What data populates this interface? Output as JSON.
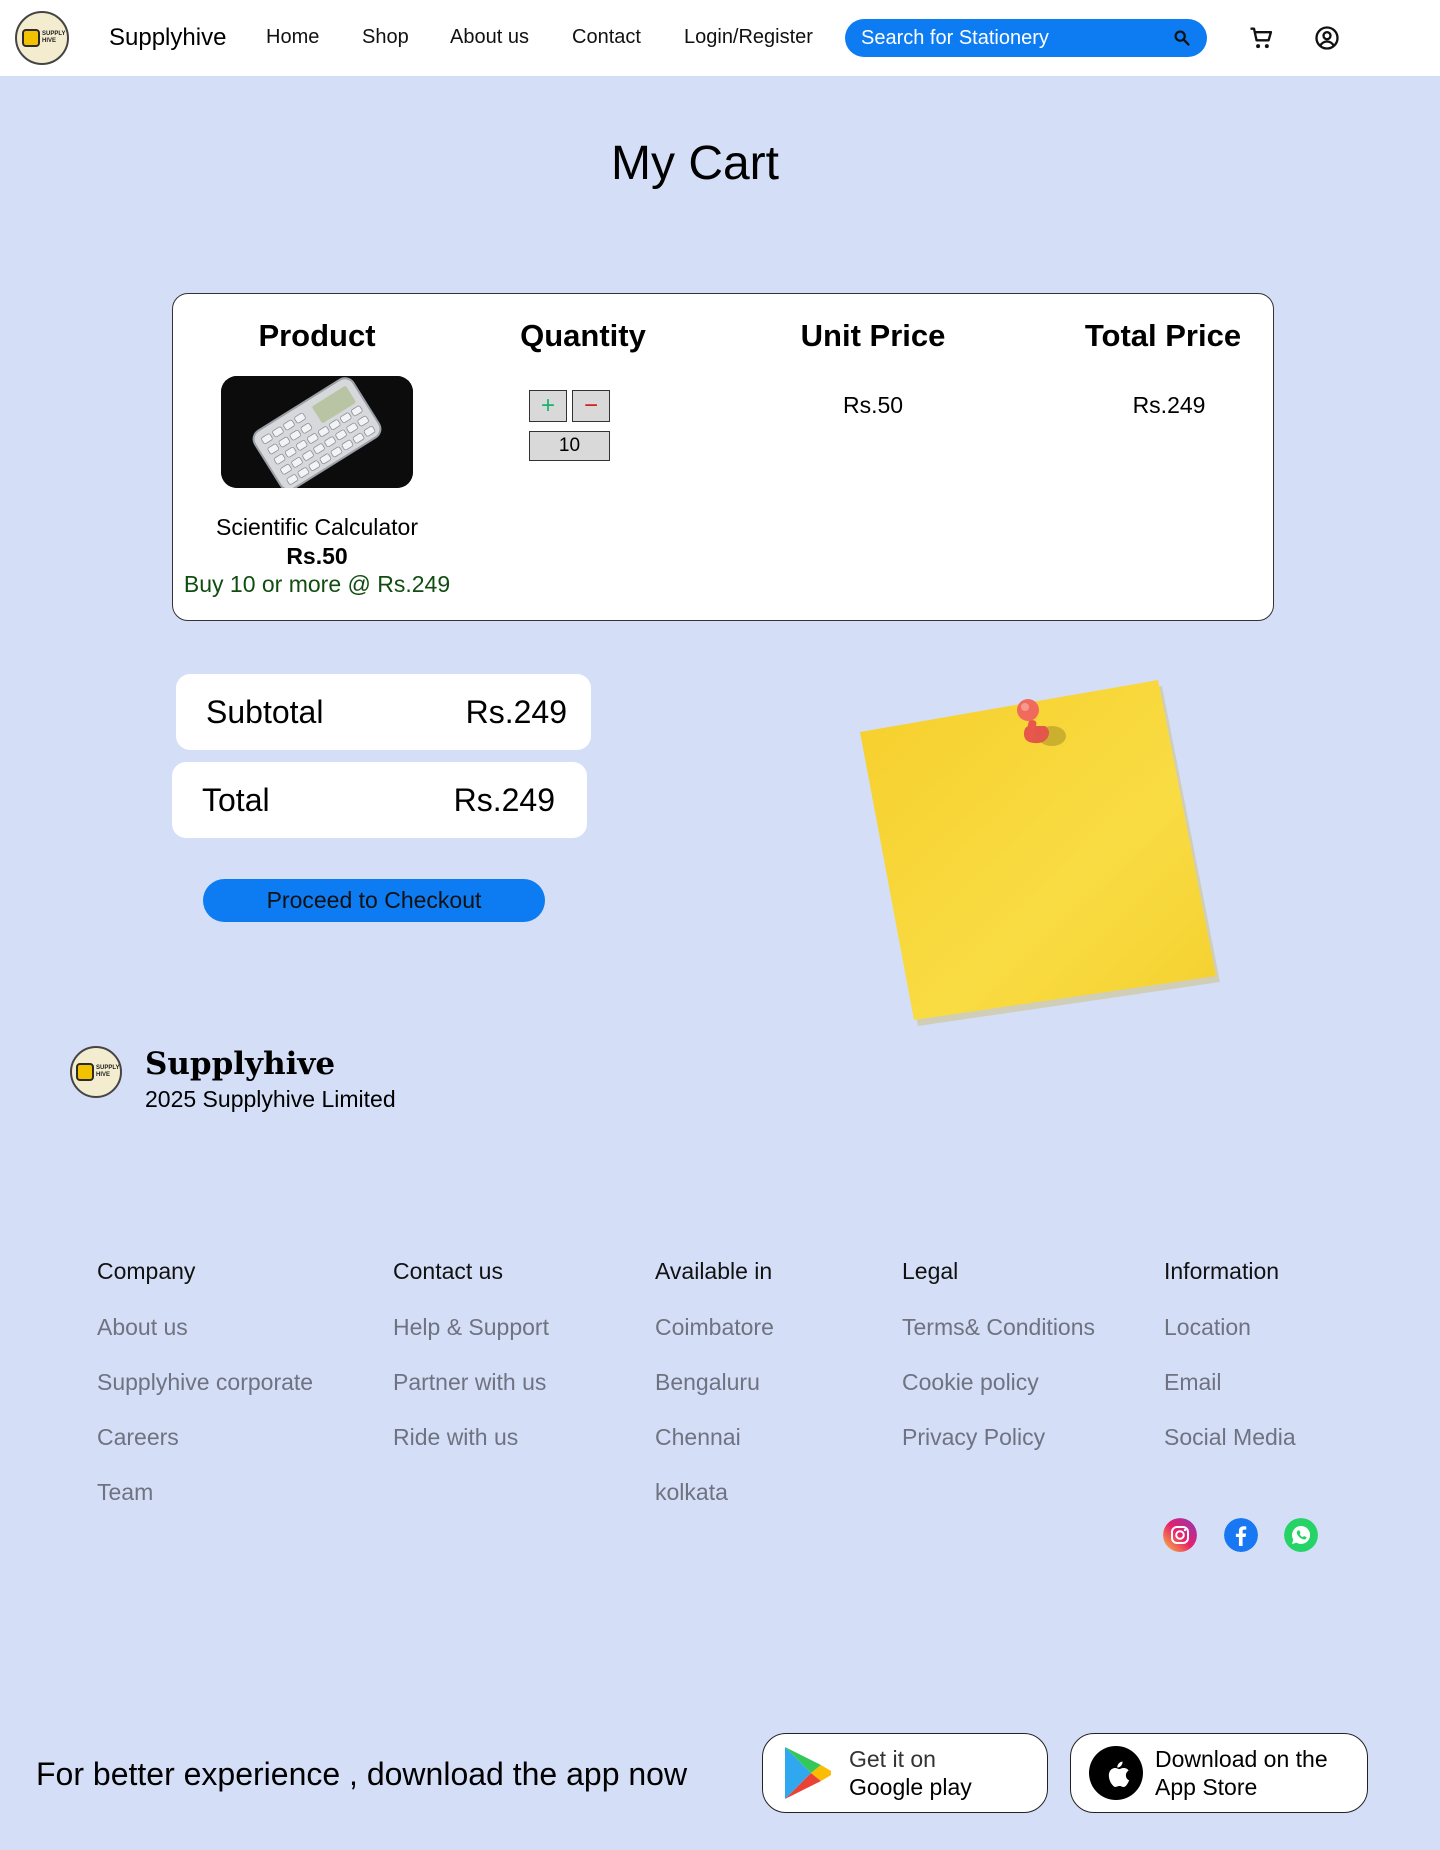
{
  "header": {
    "brand": "Supplyhive",
    "logo_text": "SUPPLY HIVE",
    "nav": [
      "Home",
      "Shop",
      "About us",
      "Contact",
      "Login/Register"
    ],
    "search_placeholder": "Search for Stationery",
    "icons": [
      "search-icon",
      "cart-icon",
      "user-icon"
    ]
  },
  "page_title": "My Cart",
  "cart": {
    "columns": [
      "Product",
      "Quantity",
      "Unit Price",
      "Total Price"
    ],
    "item": {
      "name": "Scientific Calculator",
      "price": "Rs.50",
      "offer": "Buy 10 or more @ Rs.249",
      "plus": "+",
      "minus": "−",
      "quantity": "10",
      "unit_price": "Rs.50",
      "total_price": "Rs.249"
    }
  },
  "summary": {
    "subtotal_label": "Subtotal",
    "subtotal_value": "Rs.249",
    "total_label": "Total",
    "total_value": "Rs.249",
    "checkout_label": "Proceed to Checkout"
  },
  "footer": {
    "brand": "Supplyhive",
    "copyright": "2025 Supplyhive Limited",
    "columns": [
      {
        "title": "Company",
        "links": [
          "About us",
          "Supplyhive corporate",
          "Careers",
          "Team"
        ]
      },
      {
        "title": "Contact us",
        "links": [
          "Help & Support",
          "Partner with us",
          "Ride with us"
        ]
      },
      {
        "title": "Available in",
        "links": [
          "Coimbatore",
          "Bengaluru",
          "Chennai",
          "kolkata"
        ]
      },
      {
        "title": "Legal",
        "links": [
          "Terms& Conditions",
          "Cookie policy",
          "Privacy Policy"
        ]
      },
      {
        "title": "Information",
        "links": [
          "Location",
          "Email",
          "Social Media"
        ]
      }
    ],
    "social_icons": [
      "instagram-icon",
      "facebook-icon",
      "whatsapp-icon"
    ],
    "download_text": "For better experience , download the app now",
    "google_play": {
      "line1": "Get it on",
      "line2": "Google play"
    },
    "app_store": {
      "line1": "Download on the",
      "line2": "App Store"
    }
  },
  "colors": {
    "background": "#d4dff7",
    "accent": "#0d7bf2",
    "offer_green": "#114d11",
    "link_gray": "#6f7280",
    "sticky_note": "#f7d63a"
  }
}
